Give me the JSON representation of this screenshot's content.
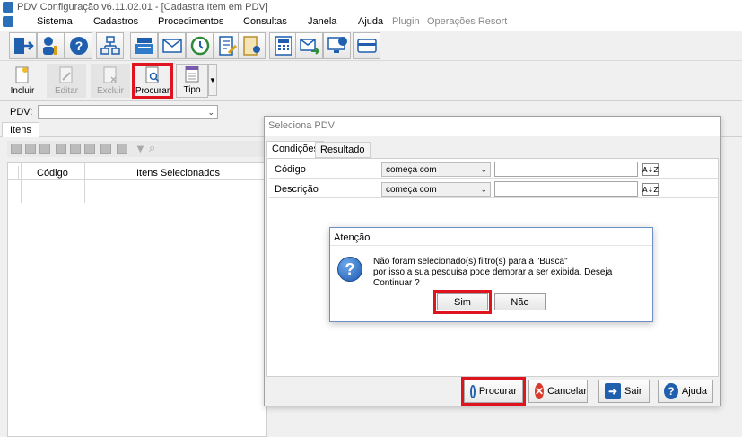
{
  "window": {
    "title": "PDV Configuração v6.11.02.01 - [Cadastra Item em PDV]"
  },
  "menu": [
    "Sistema",
    "Cadastros",
    "Procedimentos",
    "Consultas",
    "Janela",
    "Ajuda",
    "Plugin",
    "Operações Resort"
  ],
  "toolbar_icons": [
    "exit-icon",
    "user-key-icon",
    "help-icon",
    "network-icon",
    "cash-register-icon",
    "mail-icon",
    "clock-icon",
    "document-edit-icon",
    "document-user-icon",
    "calculator-icon",
    "mail-forward-icon",
    "monitor-info-icon",
    "card-icon"
  ],
  "actions": {
    "incluir": "Incluir",
    "editar": "Editar",
    "excluir": "Excluir",
    "procurar": "Procurar",
    "tipo": "Tipo"
  },
  "pdv": {
    "label": "PDV:",
    "value": ""
  },
  "left_tab": "Itens",
  "grid": {
    "columns": [
      "Código",
      "Itens Selecionados"
    ]
  },
  "dialog": {
    "title": "Seleciona PDV",
    "tabs": [
      "Condições",
      "Resultado"
    ],
    "filters": [
      {
        "label": "Código",
        "operator": "começa com",
        "value": ""
      },
      {
        "label": "Descrição",
        "operator": "começa com",
        "value": ""
      }
    ],
    "buttons": {
      "procurar": "Procurar",
      "cancelar": "Cancelar",
      "sair": "Sair",
      "ajuda": "Ajuda"
    }
  },
  "message": {
    "title": "Atenção",
    "line1": "Não foram selecionado(s) filtro(s) para a \"Busca\"",
    "line2": "por isso a sua pesquisa pode demorar a ser exibida. Deseja Continuar ?",
    "yes": "Sim",
    "no": "Não"
  },
  "colors": {
    "highlight": "#e0141e",
    "brand": "#2a6fb8"
  }
}
